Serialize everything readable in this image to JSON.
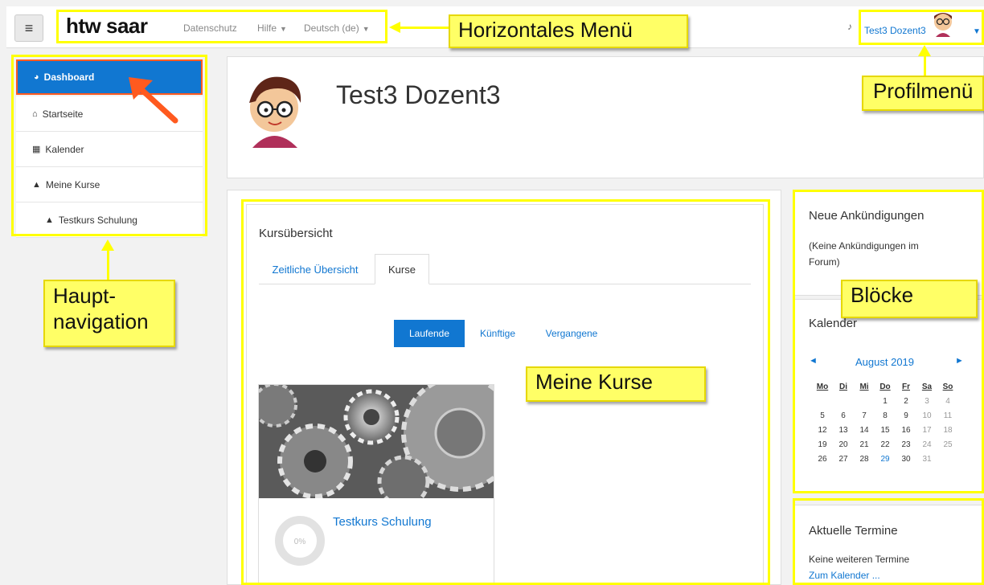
{
  "header": {
    "menu_icon": "hamburger-icon",
    "logo": "htw saar",
    "nav": [
      "Datenschutz",
      "Hilfe",
      "Deutsch (de)"
    ],
    "bell_icon": "bell-icon",
    "user_name": "Test3 Dozent3"
  },
  "sidebar": {
    "items": [
      {
        "label": "Dashboard",
        "icon": "dashboard-icon"
      },
      {
        "label": "Startseite",
        "icon": "home-icon"
      },
      {
        "label": "Kalender",
        "icon": "calendar-icon"
      },
      {
        "label": "Meine Kurse",
        "icon": "graduation-cap-icon"
      },
      {
        "label": "Testkurs Schulung",
        "icon": "graduation-cap-icon"
      }
    ]
  },
  "profile": {
    "name": "Test3 Dozent3"
  },
  "course_overview": {
    "title": "Kursübersicht",
    "tabs": [
      "Zeitliche Übersicht",
      "Kurse"
    ],
    "filters": [
      "Laufende",
      "Künftige",
      "Vergangene"
    ],
    "course": {
      "name": "Testkurs Schulung",
      "progress_label": "0%",
      "progress": 0
    }
  },
  "blocks": {
    "announcements": {
      "title": "Neue Ankündigungen",
      "text_line1": "(Keine Ankündigungen im",
      "text_line2": "Forum)"
    },
    "calendar": {
      "title": "Kalender",
      "month": "August 2019",
      "prev": "◄",
      "next": "►",
      "weekdays": [
        "Mo",
        "Di",
        "Mi",
        "Do",
        "Fr",
        "Sa",
        "So"
      ],
      "weeks": [
        [
          "",
          "",
          "",
          "1",
          "2",
          "3",
          "4"
        ],
        [
          "5",
          "6",
          "7",
          "8",
          "9",
          "10",
          "11"
        ],
        [
          "12",
          "13",
          "14",
          "15",
          "16",
          "17",
          "18"
        ],
        [
          "19",
          "20",
          "21",
          "22",
          "23",
          "24",
          "25"
        ],
        [
          "26",
          "27",
          "28",
          "29",
          "30",
          "31",
          ""
        ]
      ],
      "highlight_day": "29"
    },
    "events": {
      "title": "Aktuelle Termine",
      "text": "Keine weiteren Termine",
      "link": "Zum Kalender ..."
    }
  },
  "annotations": {
    "horizontal_menu": "Horizontales Menü",
    "profile_menu": "Profilmenü",
    "main_nav_line1": "Haupt-",
    "main_nav_line2": "navigation",
    "my_courses": "Meine Kurse",
    "blocks": "Blöcke"
  },
  "colors": {
    "accent": "#1177d1",
    "annotation": "#ffff00",
    "arrow": "#ff5a1f"
  }
}
